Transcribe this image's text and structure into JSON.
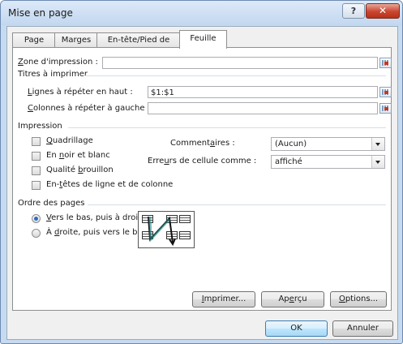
{
  "window": {
    "title": "Mise en page",
    "help_label": "?",
    "close_label": "✕"
  },
  "tabs": [
    {
      "label": "Page"
    },
    {
      "label": "Marges"
    },
    {
      "label": "En-tête/Pied de page"
    },
    {
      "label": "Feuille",
      "selected": true
    }
  ],
  "print_area": {
    "label_u": "Z",
    "label_rest": "one d'impression :",
    "value": ""
  },
  "print_titles": {
    "group_label": "Titres à imprimer",
    "rows_label_u": "L",
    "rows_label_rest": "ignes à répéter en haut :",
    "rows_value": "$1:$1",
    "cols_label_u": "C",
    "cols_label_rest": "olonnes à répéter à gauche :",
    "cols_value": ""
  },
  "print": {
    "group_label": "Impression",
    "gridlines_u": "Q",
    "gridlines_rest": "uadrillage",
    "bw_pre": "En ",
    "bw_u": "n",
    "bw_rest": "oir et blanc",
    "draft_pre": "Qualité ",
    "draft_u": "b",
    "draft_rest": "rouillon",
    "headings_pre": "En-",
    "headings_u": "t",
    "headings_rest": "êtes de ligne et de colonne",
    "comments_pre": "Comment",
    "comments_u": "a",
    "comments_rest": "ires :",
    "comments_value": "(Aucun)",
    "errors_pre": "Erre",
    "errors_u": "u",
    "errors_rest": "rs de cellule comme :",
    "errors_value": "affiché"
  },
  "page_order": {
    "group_label": "Ordre des pages",
    "down_u": "V",
    "down_rest": "ers le bas, puis à droite",
    "over_pre": "À ",
    "over_u": "d",
    "over_rest": "roite, puis vers le bas"
  },
  "buttons": {
    "print_u": "I",
    "print_rest": "mprimer...",
    "preview_pre": "Ap",
    "preview_u": "e",
    "preview_rest": "rçu",
    "options_u": "O",
    "options_rest": "ptions...",
    "ok": "OK",
    "cancel": "Annuler"
  },
  "icons": {
    "collapse": "collapse-dialog-icon",
    "page_order_diagram": "page-order-diagram-icon",
    "cursor": "mouse-pointer-icon"
  },
  "colors": {
    "titlebar": "#c2d7ef",
    "close": "#c9452f",
    "radio_selected": "#2a6cc7"
  }
}
